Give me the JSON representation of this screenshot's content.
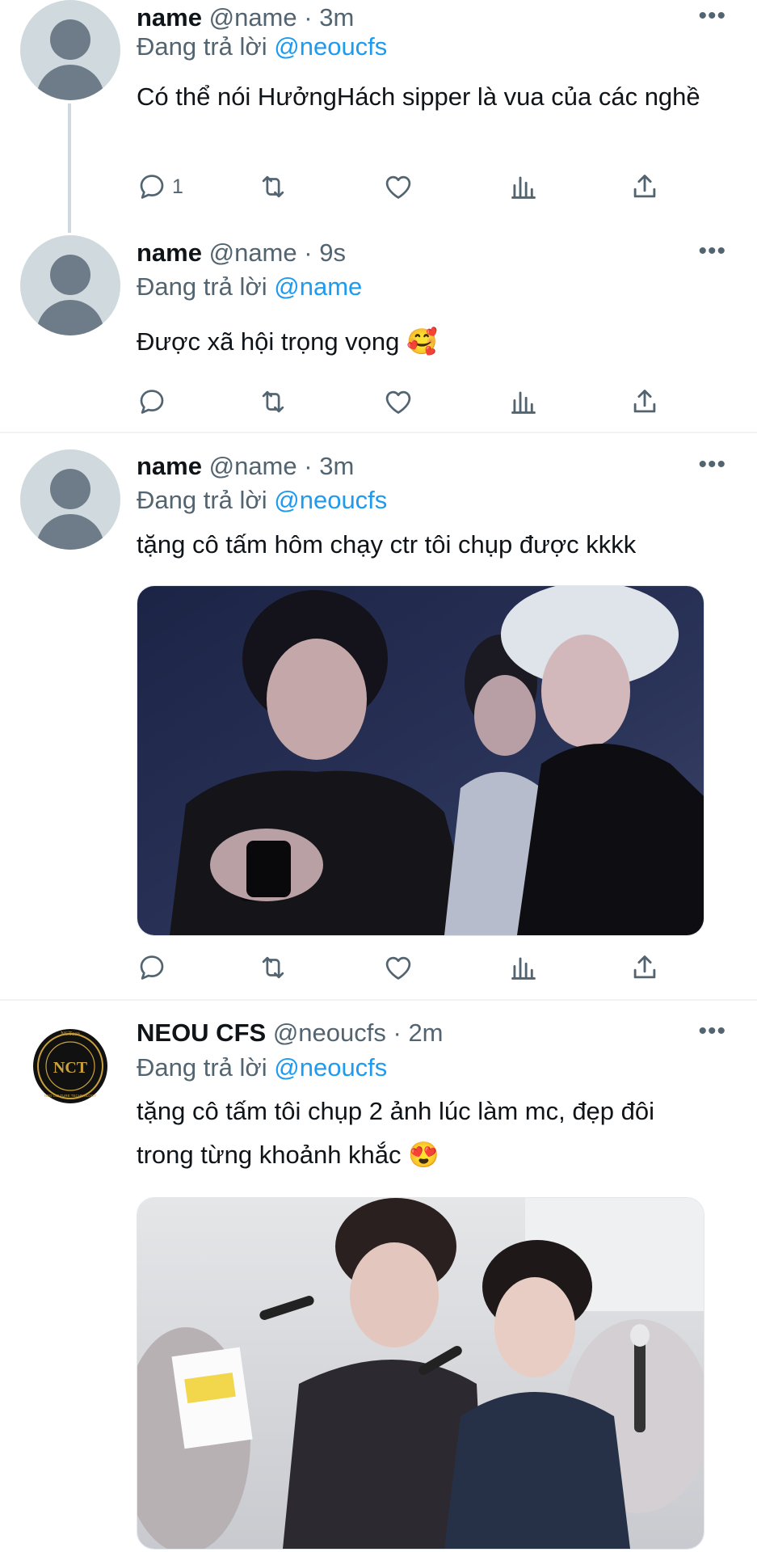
{
  "tweets": [
    {
      "name": "name",
      "handle": "@name",
      "time": "3m",
      "reply_prefix": "Đang trả lời",
      "reply_to": "@neoucfs",
      "text": "Có thể nói HưởngHách sipper là vua của các nghề",
      "reply_count": "1"
    },
    {
      "name": "name",
      "handle": "@name",
      "time": "9s",
      "reply_prefix": "Đang trả lời",
      "reply_to": "@name",
      "text": "Được xã hội trọng vọng",
      "emoji": "🥰"
    },
    {
      "name": "name",
      "handle": "@name",
      "time": "3m",
      "reply_prefix": "Đang trả lời",
      "reply_to": "@neoucfs",
      "text": "tặng cô tấm hôm chạy ctr tôi chụp được kkkk"
    },
    {
      "name": "NEOU CFS",
      "handle": "@neoucfs",
      "time": "2m",
      "reply_prefix": "Đang trả lời",
      "reply_to": "@neoucfs",
      "text": "tặng cô tấm tôi chụp 2 ảnh lúc làm mc, đẹp đôi trong từng khoảnh khắc",
      "emoji": "😍"
    }
  ],
  "logo_text": {
    "top": "NCTzen",
    "monogram": "NCT",
    "ring": "NEO CULTURE TECHNOLOGY"
  },
  "separator": "·",
  "more_glyph": "•••",
  "colors": {
    "accent": "#1d9bf0",
    "secondary_text": "#536471",
    "avatar_bg": "#cfd9de"
  }
}
